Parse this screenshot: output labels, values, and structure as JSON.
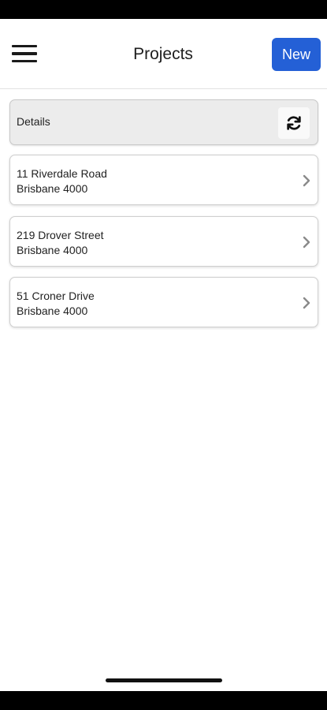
{
  "header": {
    "title": "Projects",
    "new_label": "New"
  },
  "details": {
    "label": "Details"
  },
  "projects": [
    {
      "line1": "11 Riverdale Road",
      "line2": "Brisbane 4000"
    },
    {
      "line1": "219 Drover Street",
      "line2": "Brisbane 4000"
    },
    {
      "line1": "51 Croner Drive",
      "line2": "Brisbane 4000"
    }
  ],
  "icons": {
    "menu": "hamburger-menu-icon",
    "refresh": "refresh-icon",
    "chevron": "chevron-right-icon"
  },
  "colors": {
    "accent": "#2460d6",
    "details_bg": "#ececec"
  }
}
